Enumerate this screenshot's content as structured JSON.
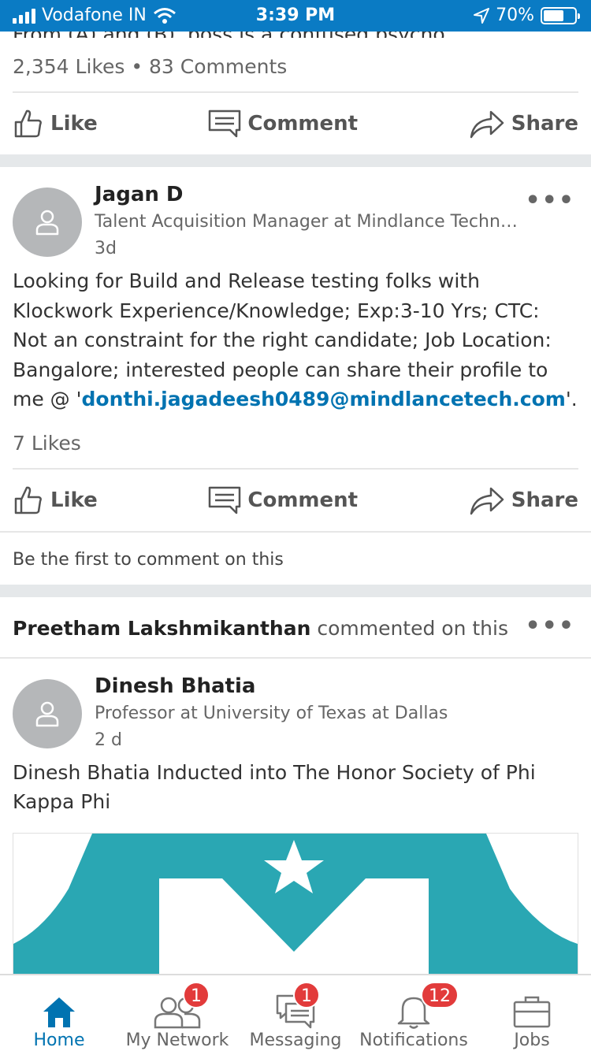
{
  "status_bar": {
    "carrier": "Vodafone IN",
    "time": "3:39 PM",
    "battery_percent": 70,
    "battery_label": "70%"
  },
  "previous_post": {
    "partial_text": "From (A) and (B), boss is a confused psycho",
    "stats": "2,354 Likes • 83 Comments"
  },
  "actions": {
    "like": "Like",
    "comment": "Comment",
    "share": "Share"
  },
  "post1": {
    "author": "Jagan D",
    "headline": "Talent Acquisition Manager at Mindlance Techn…",
    "time": "3d",
    "body": "Looking for Build and Release testing folks with Klockwork Experience/Knowledge; Exp:3-10 Yrs; CTC: Not an constraint for the right candidate; Job Location: Bangalore; interested people can share their profile to me @ '",
    "link": "donthi.jagadeesh0489@mindlancetech.com",
    "body_end": "'.",
    "stats": "7 Likes",
    "first_comment": "Be the first to comment on this"
  },
  "post2": {
    "commenter": "Preetham Lakshmikanthan",
    "commented_text": " commented on this",
    "author": "Dinesh Bhatia",
    "headline": "Professor at University of Texas at Dallas",
    "time": "2 d",
    "body": "Dinesh Bhatia  Inducted into The Honor Society of Phi Kappa Phi",
    "image_color": "#2aa7b3"
  },
  "tabs": [
    {
      "label": "Home",
      "icon": "home-icon",
      "badge": ""
    },
    {
      "label": "My Network",
      "icon": "network-icon",
      "badge": "1"
    },
    {
      "label": "Messaging",
      "icon": "messaging-icon",
      "badge": "1"
    },
    {
      "label": "Notifications",
      "icon": "bell-icon",
      "badge": "12"
    },
    {
      "label": "Jobs",
      "icon": "briefcase-icon",
      "badge": ""
    }
  ],
  "colors": {
    "status_bar": "#0a7bc4",
    "link": "#0073b1",
    "badge": "#e23b3b"
  }
}
